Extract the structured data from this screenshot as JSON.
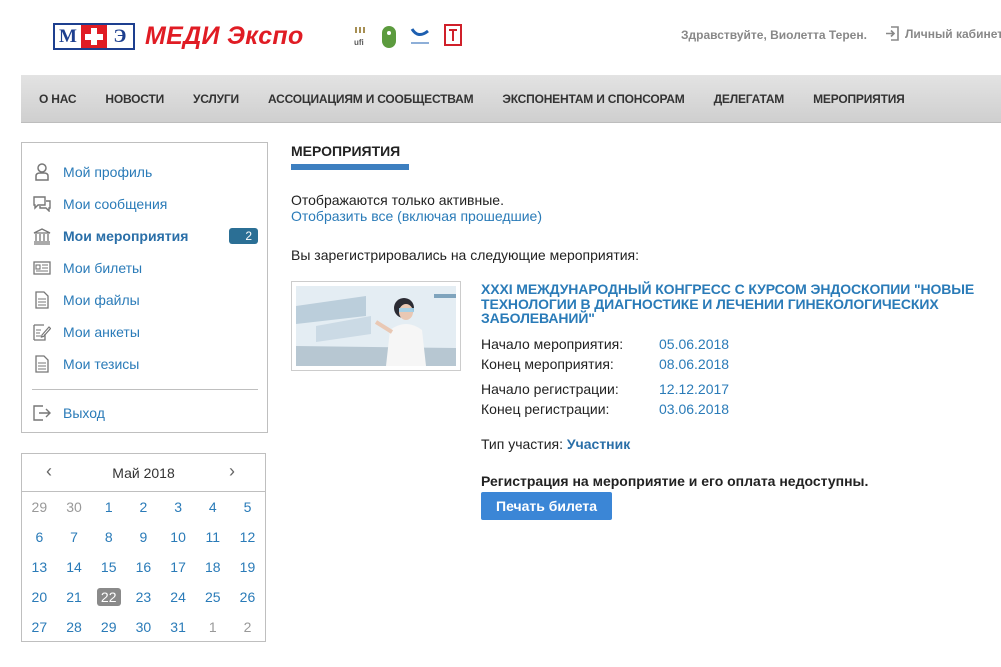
{
  "header": {
    "logo_letters": [
      "М",
      "Э"
    ],
    "logo_text": "МЕДИ Экспо",
    "partners": [
      "ufi-logo",
      "green-logo",
      "wave-logo",
      "shield-logo"
    ],
    "greeting": "Здравствуйте, Виолетта Терен.",
    "cabinet_label": "Личный кабинет"
  },
  "nav": {
    "items": [
      "О НАС",
      "НОВОСТИ",
      "УСЛУГИ",
      "АССОЦИАЦИЯМ И СООБЩЕСТВАМ",
      "ЭКСПОНЕНТАМ И СПОНСОРАМ",
      "ДЕЛЕГАТАМ",
      "МЕРОПРИЯТИЯ"
    ]
  },
  "sidebar": {
    "items": [
      {
        "label": "Мой профиль",
        "icon": "user-icon"
      },
      {
        "label": "Мои сообщения",
        "icon": "chat-icon"
      },
      {
        "label": "Мои мероприятия",
        "icon": "institution-icon",
        "badge": "2",
        "active": true
      },
      {
        "label": "Мои билеты",
        "icon": "ticket-icon"
      },
      {
        "label": "Мои файлы",
        "icon": "file-icon"
      },
      {
        "label": "Мои анкеты",
        "icon": "form-icon"
      },
      {
        "label": "Мои тезисы",
        "icon": "document-icon"
      }
    ],
    "logout_label": "Выход"
  },
  "calendar": {
    "title": "Май 2018",
    "prev": "‹",
    "next": "›",
    "weeks": [
      [
        "29",
        "30",
        "1",
        "2",
        "3",
        "4",
        "5"
      ],
      [
        "6",
        "7",
        "8",
        "9",
        "10",
        "11",
        "12"
      ],
      [
        "13",
        "14",
        "15",
        "16",
        "17",
        "18",
        "19"
      ],
      [
        "20",
        "21",
        "22",
        "23",
        "24",
        "25",
        "26"
      ],
      [
        "27",
        "28",
        "29",
        "30",
        "31",
        "1",
        "2"
      ]
    ],
    "today": "22"
  },
  "main": {
    "title": "МЕРОПРИЯТИЯ",
    "only_active": "Отображаются только активные.",
    "show_all": "Отобразить все (включая прошедшие)",
    "registered": "Вы зарегистрировались на следующие мероприятия:",
    "event": {
      "title": "XXXI Международный конгресс с курсом эндоскопии \"Новые технологии в диагностике и лечении гинекологических заболеваний\"",
      "dates": [
        {
          "label": "Начало мероприятия:",
          "value": "05.06.2018"
        },
        {
          "label": "Конец мероприятия:",
          "value": "08.06.2018"
        },
        {
          "label": "Начало регистрации:",
          "value": "12.12.2017"
        },
        {
          "label": "Конец регистрации:",
          "value": "03.06.2018"
        }
      ],
      "participation_label": "Тип участия:",
      "participation_value": "Участник",
      "notice": "Регистрация на мероприятие и его оплата недоступны.",
      "print_button": "Печать билета"
    }
  }
}
